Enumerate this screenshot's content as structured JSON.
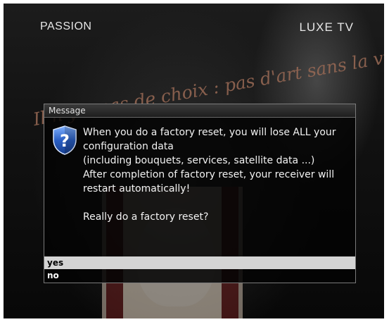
{
  "tv": {
    "channel_left": "PASSION",
    "channel_right": "LUXE TV",
    "background_text": "Il n'y a pas de choix : pas d'art sans la vie."
  },
  "dialog": {
    "title": "Message",
    "icon": "shield-question-icon",
    "lines": [
      "When you do a factory reset, you will lose ALL your",
      "configuration data",
      "(including bouquets, services, satellite data ...)",
      "After completion of factory reset, your receiver will",
      "restart automatically!"
    ],
    "question": "Really do a factory reset?",
    "options": [
      {
        "label": "yes",
        "selected": true
      },
      {
        "label": "no",
        "selected": false
      }
    ]
  },
  "colors": {
    "selection": "#d4d4d4",
    "dialog_border": "#7a7a7a",
    "icon_shield": "#2a5fc4"
  }
}
